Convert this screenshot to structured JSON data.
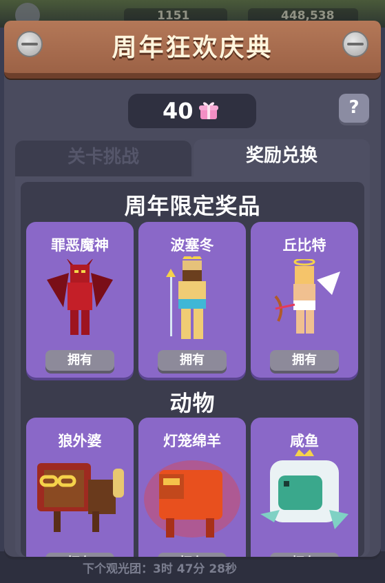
{
  "topbar": {
    "energy": "1151",
    "coins": "448,538"
  },
  "header": {
    "title": "周年狂欢庆典"
  },
  "currency": {
    "value": "40",
    "icon": "gift-box-icon"
  },
  "help": {
    "label": "?"
  },
  "tabs": [
    {
      "label": "关卡挑战",
      "active": false
    },
    {
      "label": "奖励兑换",
      "active": true
    }
  ],
  "sections": [
    {
      "title": "周年限定奖品",
      "items": [
        {
          "name": "罪恶魔神",
          "button": "拥有"
        },
        {
          "name": "波塞冬",
          "button": "拥有"
        },
        {
          "name": "丘比特",
          "button": "拥有"
        }
      ]
    },
    {
      "title": "动物",
      "items": [
        {
          "name": "狼外婆",
          "button": "拥有"
        },
        {
          "name": "灯笼绵羊",
          "button": "拥有"
        },
        {
          "name": "咸鱼",
          "button": "拥有"
        }
      ]
    }
  ],
  "footer": {
    "text": "下个观光团：3时 47分 28秒"
  },
  "colors": {
    "header": "#b47858",
    "card": "#8a68c8",
    "panel": "#4a4b5e"
  }
}
